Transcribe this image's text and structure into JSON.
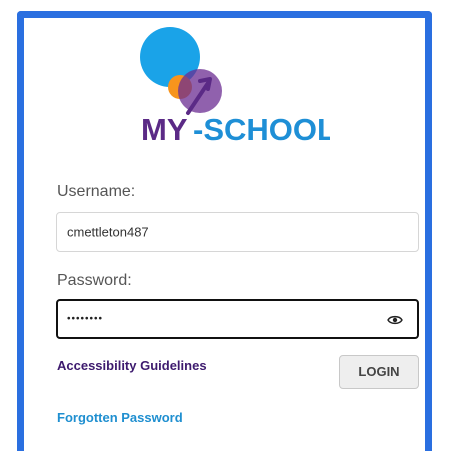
{
  "logo": {
    "text": "MY-SCHOOL",
    "colors": {
      "blue": "#1aa3e8",
      "orange": "#f7941d",
      "purple": "#6b2c91",
      "text_purple": "#5b2a86",
      "text_blue": "#1e8fd6"
    }
  },
  "form": {
    "username_label": "Username:",
    "username_value": "cmettleton487",
    "password_label": "Password:",
    "password_value": "••••••••",
    "show_password_icon": "eye-icon",
    "login_label": "LOGIN"
  },
  "links": {
    "accessibility": "Accessibility Guidelines",
    "forgot": "Forgotten Password"
  },
  "theme": {
    "frame_border": "#2a6fe0"
  }
}
